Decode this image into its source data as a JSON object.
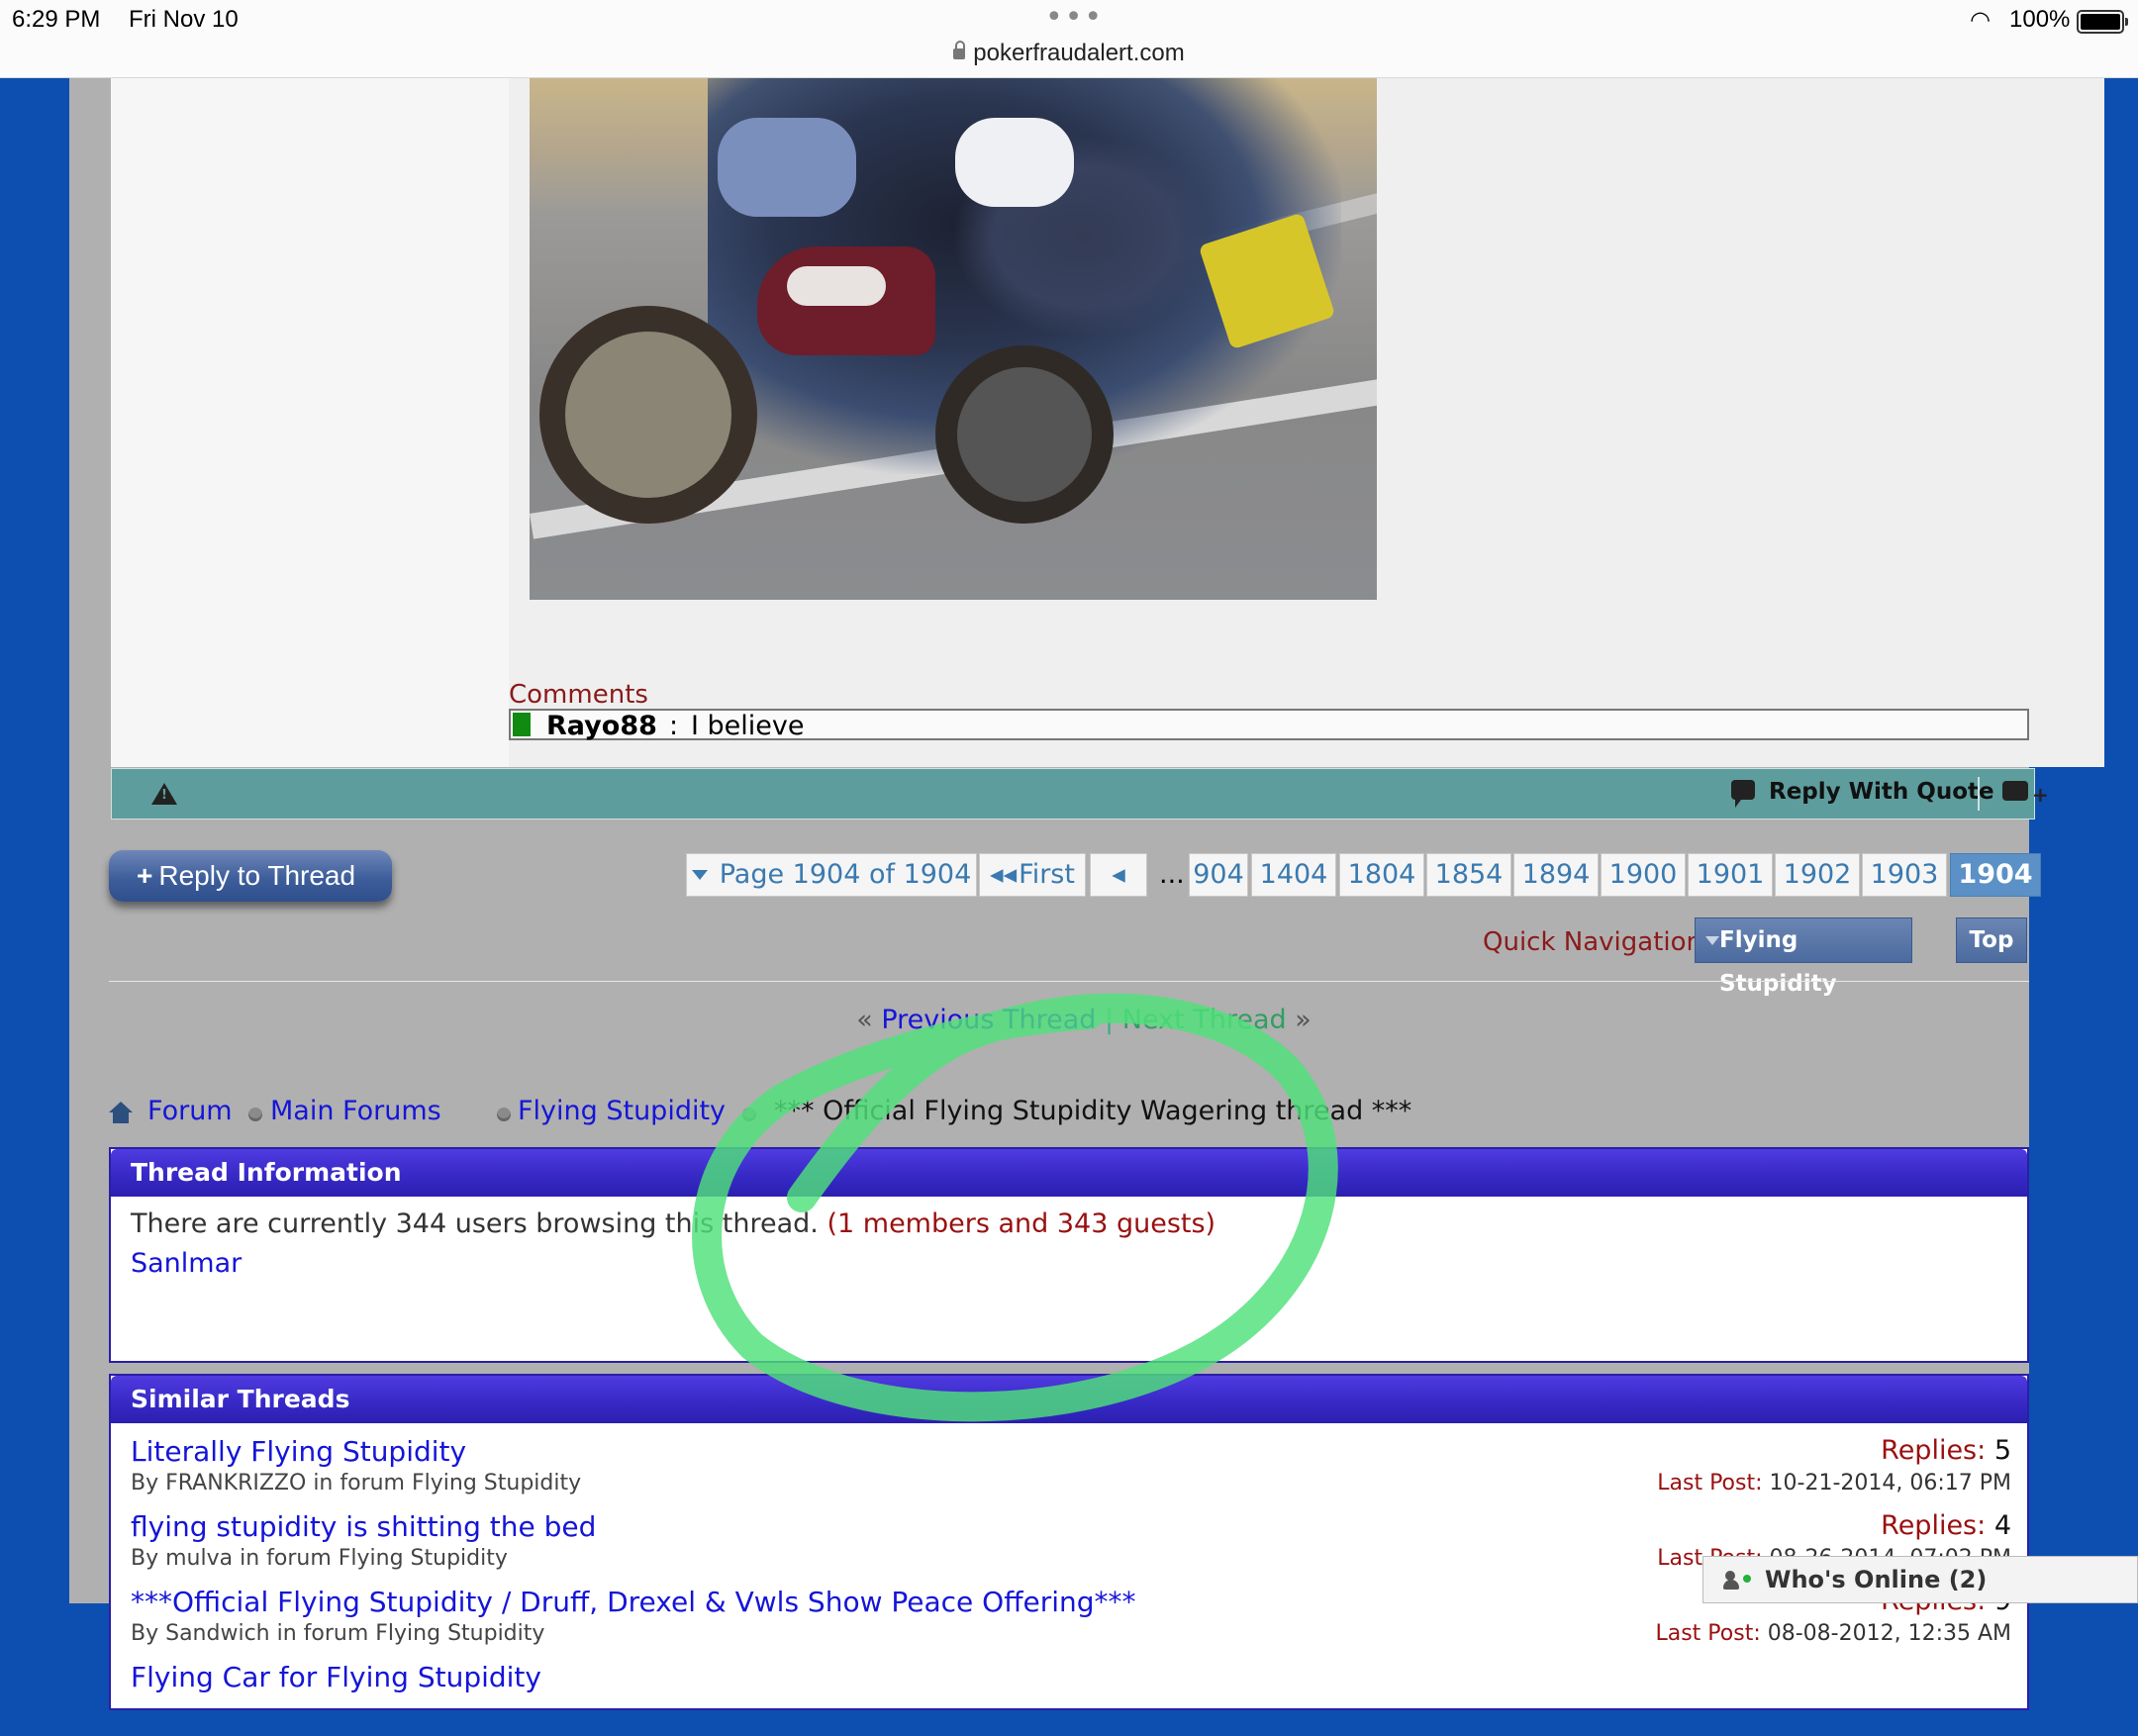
{
  "status_bar": {
    "time": "6:29 PM",
    "date": "Fri Nov 10",
    "url": "pokerfraudalert.com",
    "battery": "100%"
  },
  "post": {
    "image_alt": "Many people riding a single motorcycle",
    "comments_label": "Comments",
    "comment": {
      "user": "Rayo88",
      "separator": ":",
      "text": "I believe"
    },
    "footer": {
      "reply_with_quote": "Reply With Quote"
    }
  },
  "actions": {
    "reply_to_thread": "Reply to Thread",
    "reply_plus": "+"
  },
  "pagination": {
    "summary": "Page 1904 of 1904",
    "first": "First",
    "ellipsis": "...",
    "pages": [
      "904",
      "1404",
      "1804",
      "1854",
      "1894",
      "1900",
      "1901",
      "1902",
      "1903",
      "1904"
    ],
    "current": "1904"
  },
  "quick_nav": {
    "label": "Quick Navigation",
    "selected": "Flying Stupidity",
    "top": "Top"
  },
  "thread_nav": {
    "left_quote": "«",
    "previous": "Previous Thread",
    "separator": "|",
    "next": "Next Thread",
    "right_quote": "»"
  },
  "breadcrumb": {
    "items": [
      "Forum",
      "Main Forums",
      "Flying Stupidity"
    ],
    "current": "*** Official Flying Stupidity Wagering thread ***"
  },
  "thread_info": {
    "title": "Thread Information",
    "text": "There are currently 344 users browsing this thread.",
    "count": "(1 members and 343 guests)",
    "users": [
      "Sanlmar"
    ]
  },
  "similar_threads": {
    "title": "Similar Threads",
    "replies_label": "Replies:",
    "last_post_label": "Last Post:",
    "items": [
      {
        "title": "Literally Flying Stupidity",
        "meta": "By FRANKRIZZO in forum Flying Stupidity",
        "replies": "5",
        "last_post": "10-21-2014, 06:17 PM"
      },
      {
        "title": "flying stupidity is shitting the bed",
        "meta": "By mulva in forum Flying Stupidity",
        "replies": "4",
        "last_post": "08-26-2014, 07:02 PM"
      },
      {
        "title": "***Official Flying Stupidity / Druff, Drexel & Vwls Show Peace Offering***",
        "meta": "By Sandwich in forum Flying Stupidity",
        "replies": "9",
        "last_post": "08-08-2012, 12:35 AM"
      },
      {
        "title": "Flying Car for Flying Stupidity",
        "meta": "",
        "replies": "",
        "last_post": ""
      }
    ]
  },
  "whos_online": {
    "label": "Who's Online (2)"
  },
  "colors": {
    "page_bg": "#0d4fb0",
    "link": "#1515d8",
    "accent_red": "#9a1010",
    "box_header": "#3628c4",
    "post_footer": "#5e9d9d",
    "highlight": "#4fe07a"
  }
}
